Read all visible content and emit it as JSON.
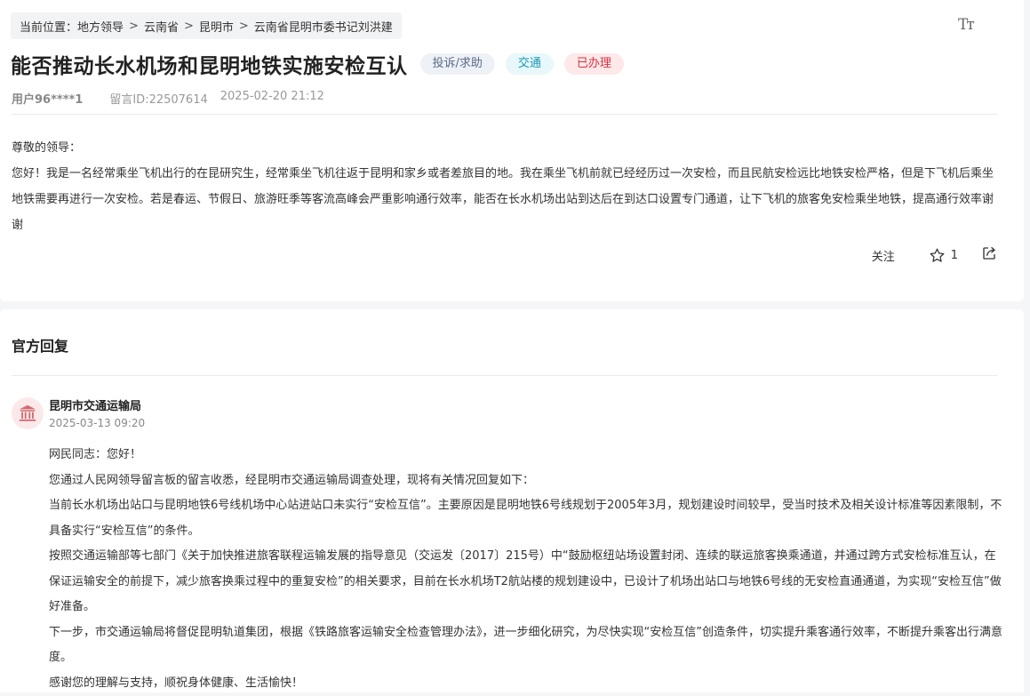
{
  "breadcrumb": {
    "prefix": "当前位置：",
    "items": [
      "地方领导",
      "云南省",
      "昆明市",
      "云南省昆明市委书记刘洪建"
    ],
    "separator": ">"
  },
  "font_size_toggle": "Tт",
  "message": {
    "title": "能否推动长水机场和昆明地铁实施安检互认",
    "tags": {
      "type": "投诉/求助",
      "topic": "交通",
      "status": "已办理"
    },
    "user": "用户96****1",
    "message_id": "留言ID:22507614",
    "datetime": "2025-02-20 21:12",
    "greeting": "尊敬的领导：",
    "body": "您好！我是一名经常乘坐飞机出行的在昆研究生，经常乘坐飞机往返于昆明和家乡或者差旅目的地。我在乘坐飞机前就已经经历过一次安检，而且民航安检远比地铁安检严格，但是下飞机后乘坐地铁需要再进行一次安检。若是春运、节假日、旅游旺季等客流高峰会严重影响通行效率，能否在长水机场出站到达后在到达口设置专门通道，让下飞机的旅客免安检乘坐地铁，提高通行效率谢谢"
  },
  "actions": {
    "follow_label": "关注",
    "favorite_count": "1"
  },
  "reply": {
    "heading": "官方回复",
    "org_name": "昆明市交通运输局",
    "datetime": "2025-03-13 09:20",
    "paragraphs": [
      "网民同志：您好！",
      "您通过人民网领导留言板的留言收悉，经昆明市交通运输局调查处理，现将有关情况回复如下：",
      "当前长水机场出站口与昆明地铁6号线机场中心站进站口未实行“安检互信”。主要原因是昆明地铁6号线规划于2005年3月，规划建设时间较早，受当时技术及相关设计标准等因素限制，不具备实行“安检互信”的条件。",
      "按照交通运输部等七部门《关于加快推进旅客联程运输发展的指导意见（交运发〔2017〕215号）中“鼓励枢纽站场设置封闭、连续的联运旅客换乘通道，并通过跨方式安检标准互认，在保证运输安全的前提下，减少旅客换乘过程中的重复安检”的相关要求，目前在长水机场T2航站楼的规划建设中，已设计了机场出站口与地铁6号线的无安检直通通道，为实现“安检互信”做好准备。",
      "下一步，市交通运输局将督促昆明轨道集团，根据《铁路旅客运输安全检查管理办法》，进一步细化研究，为尽快实现“安检互信”创造条件，切实提升乘客通行效率，不断提升乘客出行满意度。",
      "感谢您的理解与支持，顺祝身体健康、生活愉快！"
    ]
  },
  "icons": {
    "favorite": "star-outline-icon",
    "share": "share-icon",
    "org": "government-building-icon"
  },
  "colors": {
    "status_red": "#d8323f",
    "topic_teal": "#1597b2",
    "type_gray": "#5b6b86"
  }
}
